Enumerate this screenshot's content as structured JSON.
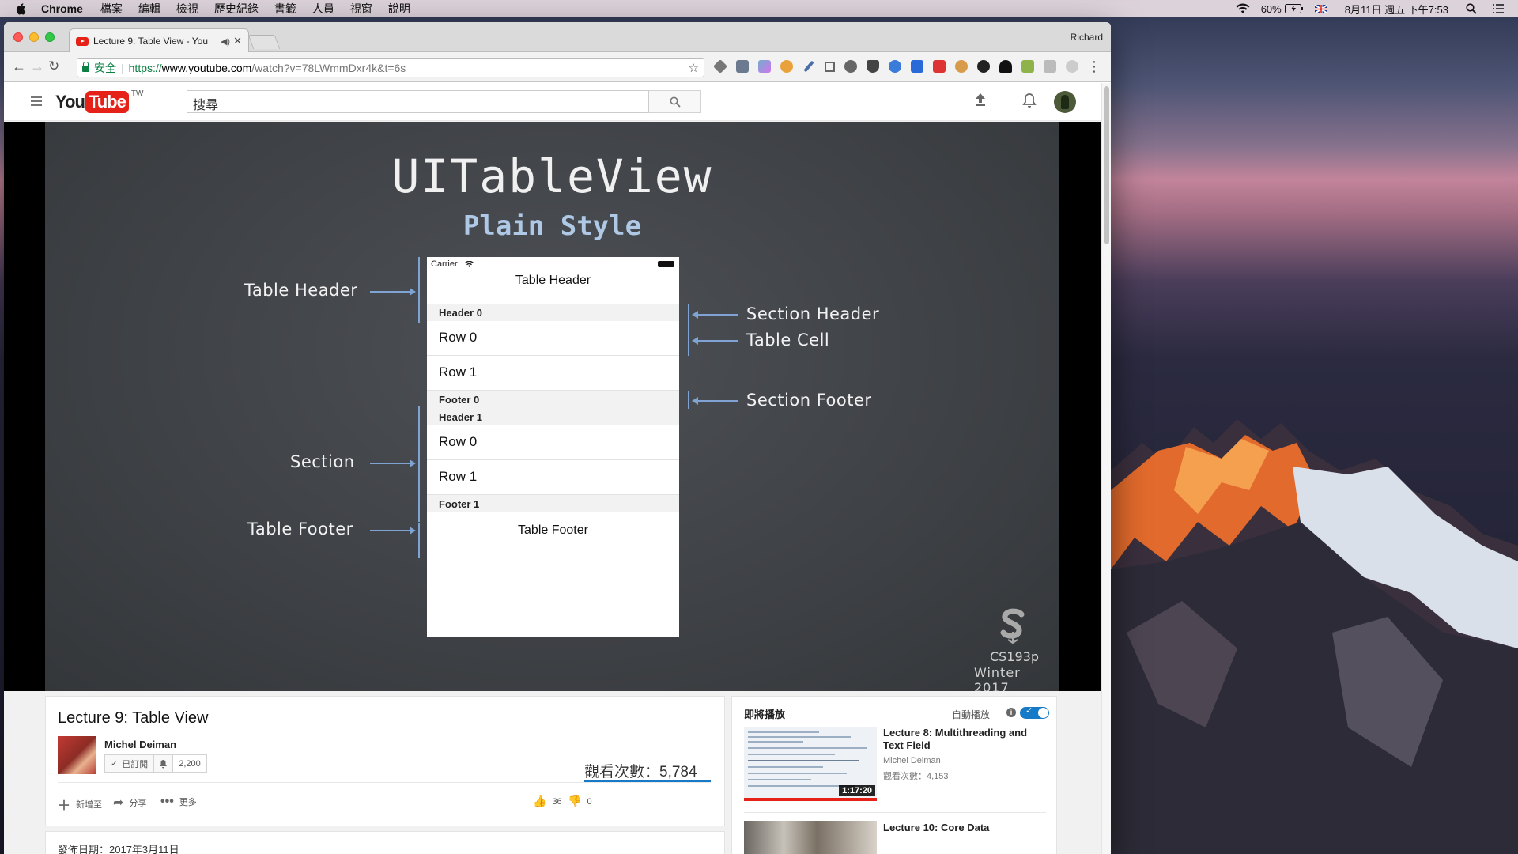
{
  "menubar": {
    "app": "Chrome",
    "items": [
      "檔案",
      "編輯",
      "檢視",
      "歷史紀錄",
      "書籤",
      "人員",
      "視窗",
      "說明"
    ],
    "battery": "60%",
    "datetime": "8月11日 週五 下午7:53"
  },
  "browser": {
    "tab_title": "Lecture 9: Table View - You",
    "profile": "Richard",
    "url_secure_label": "安全",
    "url_proto": "https://",
    "url_host": "www.youtube.com",
    "url_path": "/watch?v=78LWmmDxr4k&t=6s"
  },
  "youtube": {
    "logo_you": "You",
    "logo_tube": "Tube",
    "logo_region": "TW",
    "search_placeholder": "搜尋"
  },
  "slide": {
    "title": "UITableView",
    "subtitle": "Plain Style",
    "labels": {
      "table_header": "Table Header",
      "section": "Section",
      "table_footer": "Table Footer",
      "section_header": "Section Header",
      "table_cell": "Table Cell",
      "section_footer": "Section Footer"
    },
    "phone": {
      "carrier": "Carrier",
      "table_header": "Table Header",
      "header0": "Header 0",
      "row0a": "Row 0",
      "row1a": "Row 1",
      "footer0": "Footer 0",
      "header1": "Header 1",
      "row0b": "Row 0",
      "row1b": "Row 1",
      "footer1": "Footer 1",
      "table_footer": "Table Footer"
    },
    "course": "CS193p",
    "term": "Winter 2017"
  },
  "video": {
    "title": "Lecture 9: Table View",
    "channel": "Michel Deiman",
    "subscribed_label": "已訂閱",
    "subscriber_count": "2,200",
    "views": "觀看次數：5,784",
    "add_to": "新增至",
    "share": "分享",
    "more": "更多",
    "likes": "36",
    "dislikes": "0",
    "published": "發佈日期：2017年3月11日"
  },
  "sidebar": {
    "up_next": "即將播放",
    "autoplay": "自動播放",
    "next_title": "Lecture 8: Multithreading and Text Field",
    "next_channel": "Michel Deiman",
    "next_views": "觀看次數：4,153",
    "next_duration": "1:17:20",
    "second_title": "Lecture 10: Core Data"
  }
}
